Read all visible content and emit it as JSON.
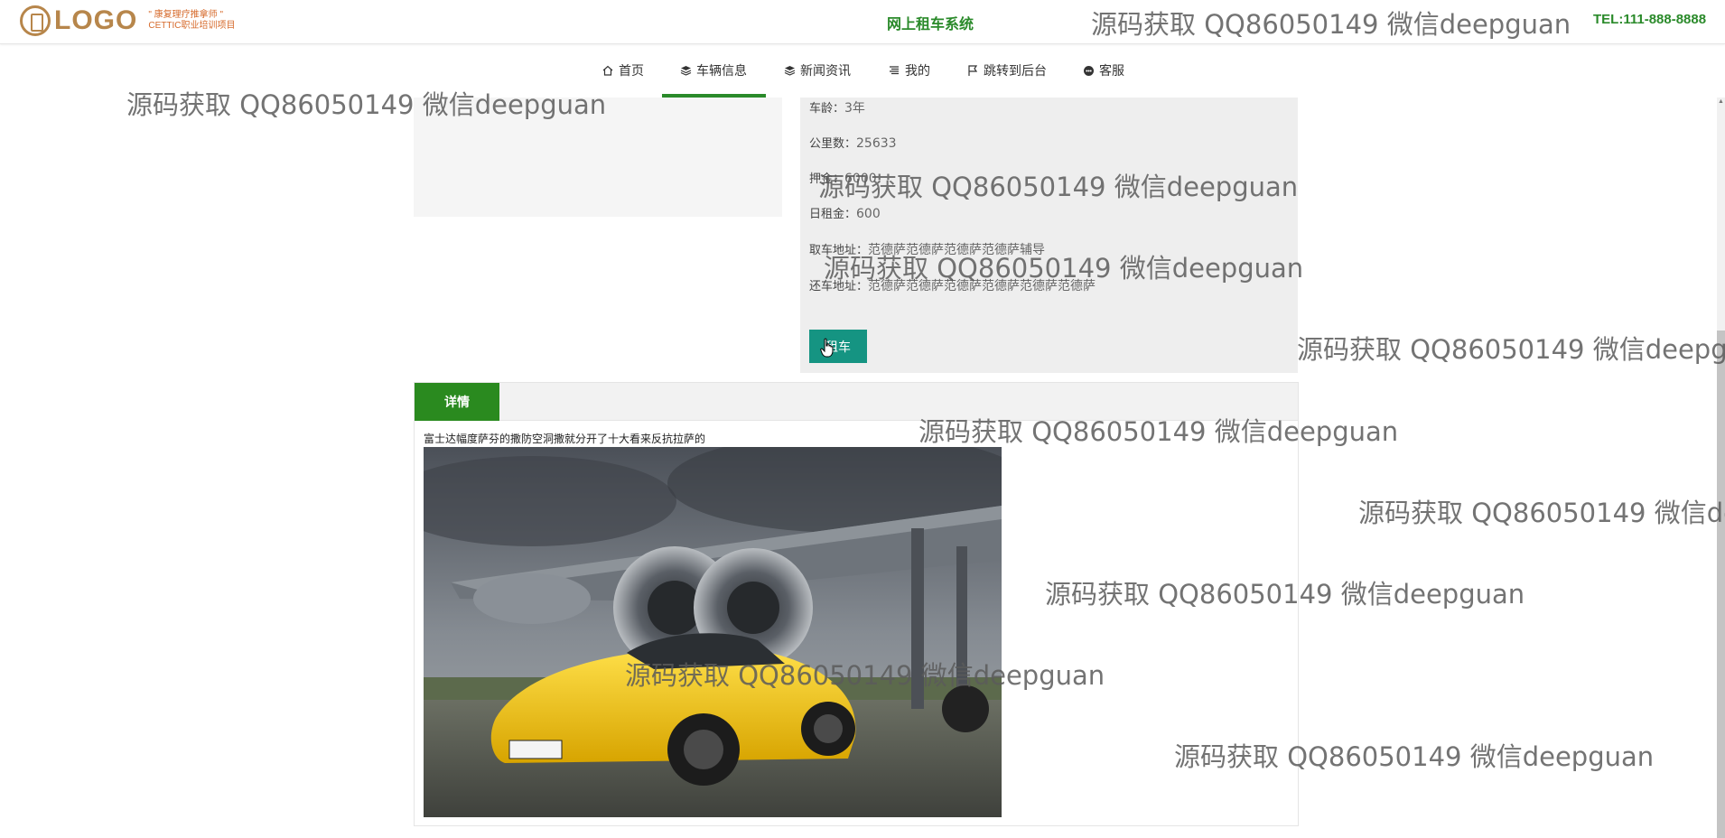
{
  "header": {
    "logo_text": "LOGO",
    "logo_tagline_1": "\" 康复理疗推拿师 \"",
    "logo_tagline_2": "CETTIC职业培训项目",
    "site_title": "网上租车系统",
    "tel": "TEL:111-888-8888"
  },
  "nav": {
    "items": [
      {
        "label": "首页",
        "icon": "home-icon"
      },
      {
        "label": "车辆信息",
        "icon": "layers-icon"
      },
      {
        "label": "新闻资讯",
        "icon": "layers-icon"
      },
      {
        "label": "我的",
        "icon": "list-icon"
      },
      {
        "label": "跳转到后台",
        "icon": "flag-icon"
      },
      {
        "label": "客服",
        "icon": "chat-icon"
      }
    ],
    "active": "车辆信息"
  },
  "car": {
    "age_label": "车龄：",
    "age": "3年",
    "mileage_label": "公里数：",
    "mileage": "25633",
    "deposit_label": "押金：",
    "deposit": "6000",
    "daily_rent_label": "日租金：",
    "daily_rent": "600",
    "pickup_label": "取车地址：",
    "pickup": "范德萨范德萨范德萨范德萨辅导",
    "return_label": "还车地址：",
    "return": "范德萨范德萨范德萨范德萨范德萨范德萨",
    "rent_button": "租车"
  },
  "details": {
    "tab_label": "详情",
    "description": "富士达幅度萨芬的撒防空洞撒就分开了十大看来反抗拉萨的"
  },
  "watermark": "源码获取 QQ86050149 微信deepguan"
}
